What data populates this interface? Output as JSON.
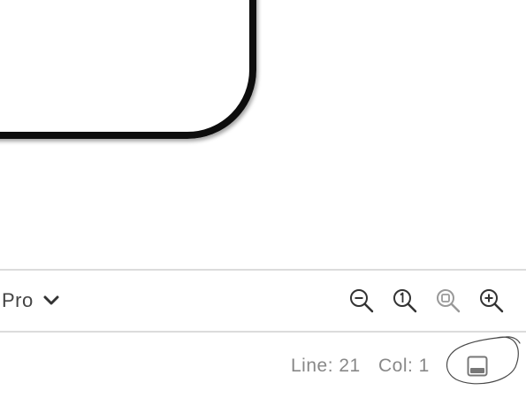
{
  "toolbar": {
    "device_label": "Pro",
    "device_dropdown_icon": "chevron-down-icon",
    "zoom_buttons": [
      {
        "name": "zoom-out-button",
        "icon": "magnifier-minus-icon"
      },
      {
        "name": "zoom-actual-size-button",
        "icon": "magnifier-one-icon"
      },
      {
        "name": "zoom-to-fit-button",
        "icon": "magnifier-fit-icon"
      },
      {
        "name": "zoom-in-button",
        "icon": "magnifier-plus-icon"
      }
    ]
  },
  "statusbar": {
    "line": "Line: 21",
    "col": "Col: 1",
    "panel_toggle_icon": "panel-bottom-icon"
  },
  "colors": {
    "frame": "#0d0d0d",
    "divider": "#dcdcdc",
    "status_text": "#888888",
    "toolbar_text": "#444444"
  }
}
